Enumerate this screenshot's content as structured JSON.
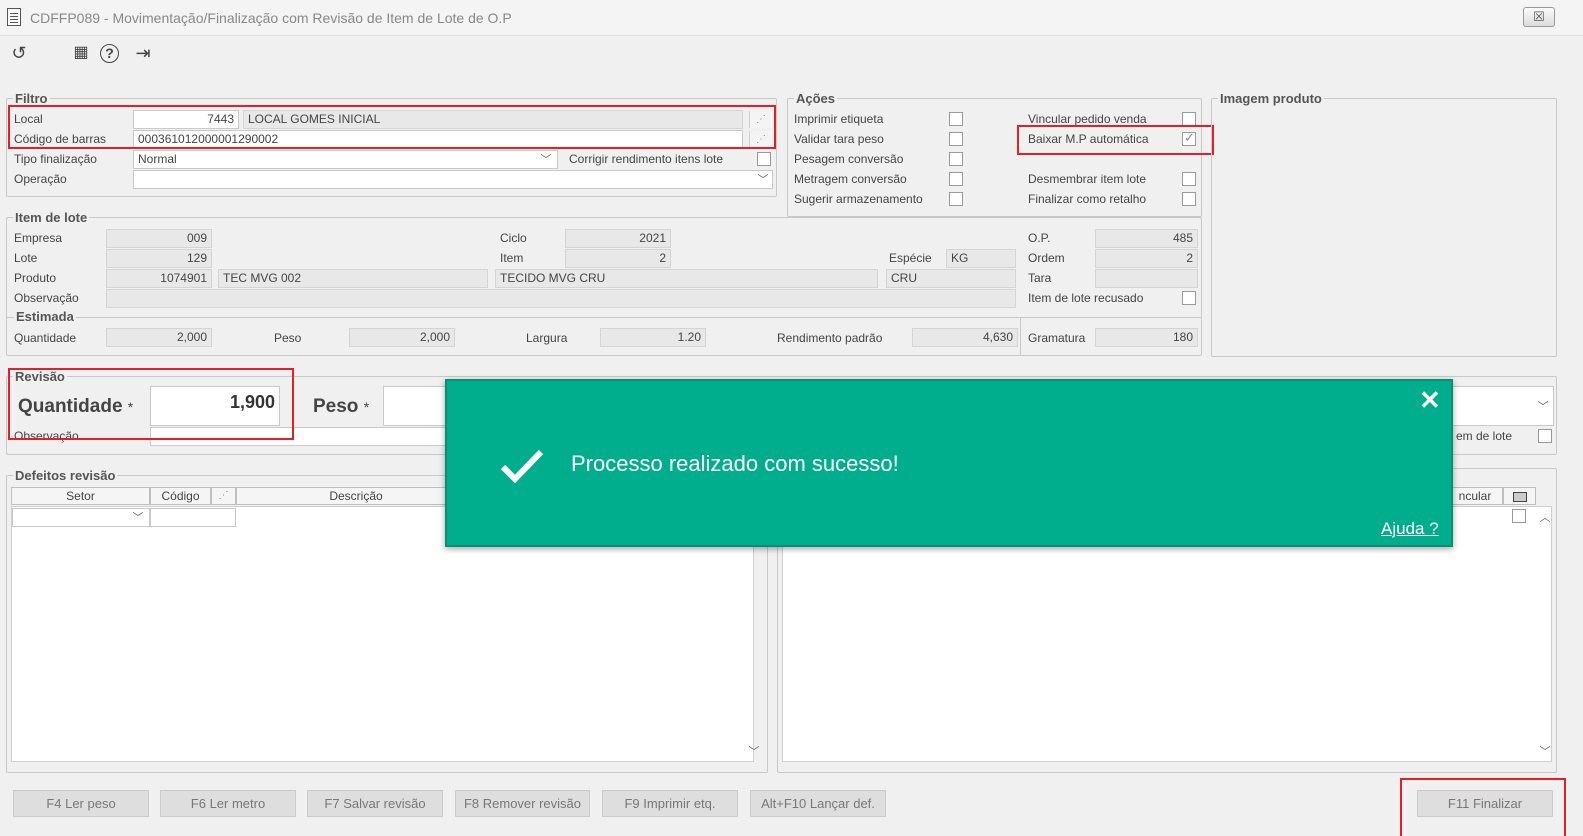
{
  "window": {
    "title": "CDFFP089 - Movimentação/Finalização com Revisão de Item de Lote de O.P",
    "close": "☒"
  },
  "toolbar": {
    "refresh": "↺",
    "calendar": "▦",
    "help": "?",
    "exit": "⇥"
  },
  "filtro": {
    "legend": "Filtro",
    "local_label": "Local",
    "local_code": "7443",
    "local_name": "LOCAL GOMES INICIAL",
    "barcode_label": "Código de barras",
    "barcode": "000361012000001290002",
    "tipo_label": "Tipo finalização",
    "tipo_value": "Normal",
    "corrigir_label": "Corrigir rendimento itens lote",
    "operacao_label": "Operação",
    "operacao_value": ""
  },
  "acoes": {
    "legend": "Ações",
    "items": [
      {
        "label": "Imprimir etiqueta",
        "checked": false
      },
      {
        "label": "Validar tara peso",
        "checked": false
      },
      {
        "label": "Pesagem conversão",
        "checked": false
      },
      {
        "label": "Metragem conversão",
        "checked": false
      },
      {
        "label": "Sugerir armazenamento",
        "checked": false
      },
      {
        "label": "Vincular pedido venda",
        "checked": false
      },
      {
        "label": "Baixar M.P automática",
        "checked": true
      },
      {
        "label": "Desmembrar item lote",
        "checked": false
      },
      {
        "label": "Finalizar como retalho",
        "checked": false
      }
    ]
  },
  "imagem": {
    "legend": "Imagem produto"
  },
  "item_lote": {
    "legend": "Item de lote",
    "empresa_label": "Empresa",
    "empresa": "009",
    "lote_label": "Lote",
    "lote": "129",
    "produto_label": "Produto",
    "produto_code": "1074901",
    "produto_ref": "TEC MVG 002",
    "produto_desc": "TECIDO MVG CRU",
    "observacao_label": "Observação",
    "observacao": "",
    "ciclo_label": "Ciclo",
    "ciclo": "2021",
    "item_label": "Item",
    "item": "2",
    "especie_label": "Espécie",
    "especie": "KG",
    "especie2": "CRU",
    "op_label": "O.P.",
    "op": "485",
    "ordem_label": "Ordem",
    "ordem": "2",
    "tara_label": "Tara",
    "tara": "",
    "recusado_label": "Item de lote recusado"
  },
  "estimada": {
    "legend": "Estimada",
    "quantidade_label": "Quantidade",
    "quantidade": "2,000",
    "peso_label": "Peso",
    "peso": "2,000",
    "largura_label": "Largura",
    "largura": "1.20",
    "rendimento_label": "Rendimento padrão",
    "rendimento": "4,630",
    "gramatura_label": "Gramatura",
    "gramatura": "180"
  },
  "revisao": {
    "legend": "Revisão",
    "quantidade_label": "Quantidade",
    "quantidade": "1,900",
    "peso_label": "Peso",
    "required": "*",
    "observacao_label": "Observação",
    "item_lote_partial": "em de lote"
  },
  "defeitos": {
    "legend": "Defeitos revisão",
    "col_setor": "Setor",
    "col_codigo": "Código",
    "col_descricao": "Descrição",
    "col_vincular": "ncular"
  },
  "toast": {
    "message": "Processo realizado com sucesso!",
    "help": "Ajuda ?",
    "close": "✕"
  },
  "buttons": {
    "f4": "F4 Ler peso",
    "f6": "F6 Ler metro",
    "f7": "F7 Salvar revisão",
    "f8": "F8 Remover revisão",
    "f9": "F9 Imprimir etq.",
    "alt_f10": "Alt+F10 Lançar def.",
    "f11": "F11 Finalizar"
  }
}
